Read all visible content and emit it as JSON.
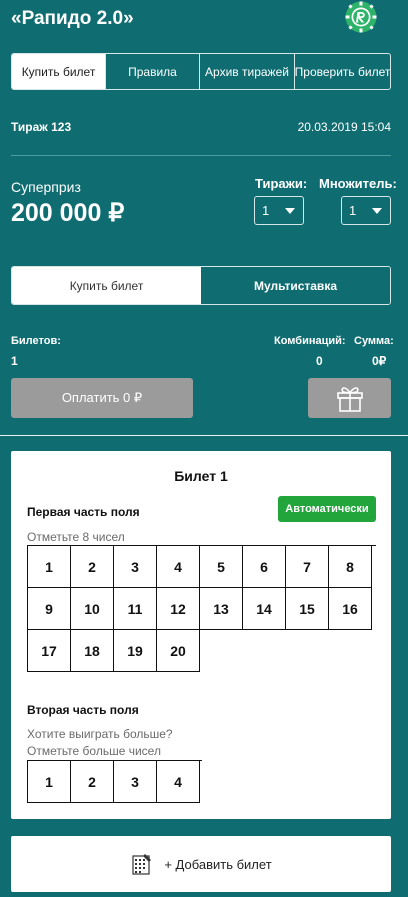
{
  "header": {
    "title": "«Рапидо 2.0»",
    "logo_icon": "rapido-logo-icon"
  },
  "tabs": [
    {
      "label": "Купить билет",
      "active": true
    },
    {
      "label": "Правила",
      "active": false
    },
    {
      "label": "Архив тиражей",
      "active": false
    },
    {
      "label": "Проверить билет",
      "active": false
    }
  ],
  "draw": {
    "label": "Тираж 123",
    "datetime": "20.03.2019 15:04"
  },
  "superprize": {
    "label": "Суперприз",
    "value": "200 000 ₽"
  },
  "selectors": {
    "draws_label": "Тиражи:",
    "draws_value": "1",
    "multiplier_label": "Множитель:",
    "multiplier_value": "1"
  },
  "mode": {
    "buy_label": "Купить билет",
    "multi_label": "Мультиставка"
  },
  "summary": {
    "tickets_label": "Билетов:",
    "tickets_value": "1",
    "combos_label": "Комбинаций:",
    "combos_value": "0",
    "sum_label": "Сумма:",
    "sum_value": "0₽"
  },
  "actions": {
    "pay_label": "Оплатить 0 ₽",
    "gift_icon": "gift-icon"
  },
  "ticket": {
    "title": "Билет 1",
    "part1_title": "Первая часть поля",
    "part1_hint": "Отметьте 8 чисел",
    "auto_label": "Автоматически",
    "part1_numbers": [
      "1",
      "2",
      "3",
      "4",
      "5",
      "6",
      "7",
      "8",
      "9",
      "10",
      "11",
      "12",
      "13",
      "14",
      "15",
      "16",
      "17",
      "18",
      "19",
      "20"
    ],
    "part2_title": "Вторая часть поля",
    "part2_hint1": "Хотите выиграть больше?",
    "part2_hint2": "Отметьте больше чисел",
    "part2_numbers": [
      "1",
      "2",
      "3",
      "4"
    ]
  },
  "add_ticket": {
    "label": "+ Добавить билет",
    "icon": "ticket-icon"
  },
  "colors": {
    "background": "#0f6d72",
    "auto_button": "#22a63b",
    "disabled_button": "#9b9b9b"
  }
}
